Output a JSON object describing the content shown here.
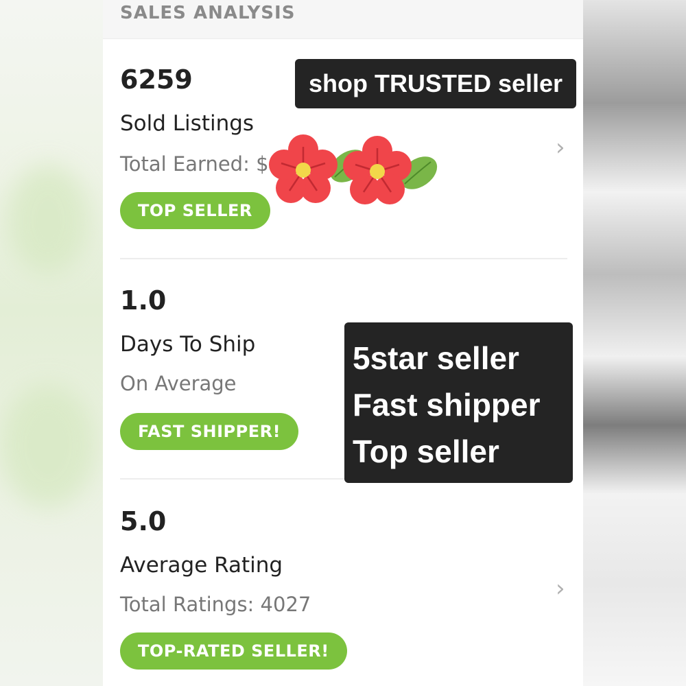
{
  "section_title": "SALES ANALYSIS",
  "stats": [
    {
      "value": "6259",
      "label": "Sold Listings",
      "sub": "Total Earned: $",
      "badge": "TOP SELLER"
    },
    {
      "value": "1.0",
      "label": "Days To Ship",
      "sub": "On Average",
      "badge": "FAST SHIPPER!"
    },
    {
      "value": "5.0",
      "label": "Average Rating",
      "sub": "Total Ratings: 4027",
      "badge": "TOP-RATED SELLER!"
    }
  ],
  "chevron_icon": "chevron-right-icon",
  "overlays": {
    "top_caption": "shop TRUSTED seller",
    "mid_lines": [
      "5star seller",
      "Fast shipper",
      "Top seller"
    ]
  },
  "colors": {
    "badge_green": "#7cc23e",
    "overlay_bg": "#242424",
    "flower_red": "#f0454a",
    "leaf_green": "#7ab648"
  }
}
